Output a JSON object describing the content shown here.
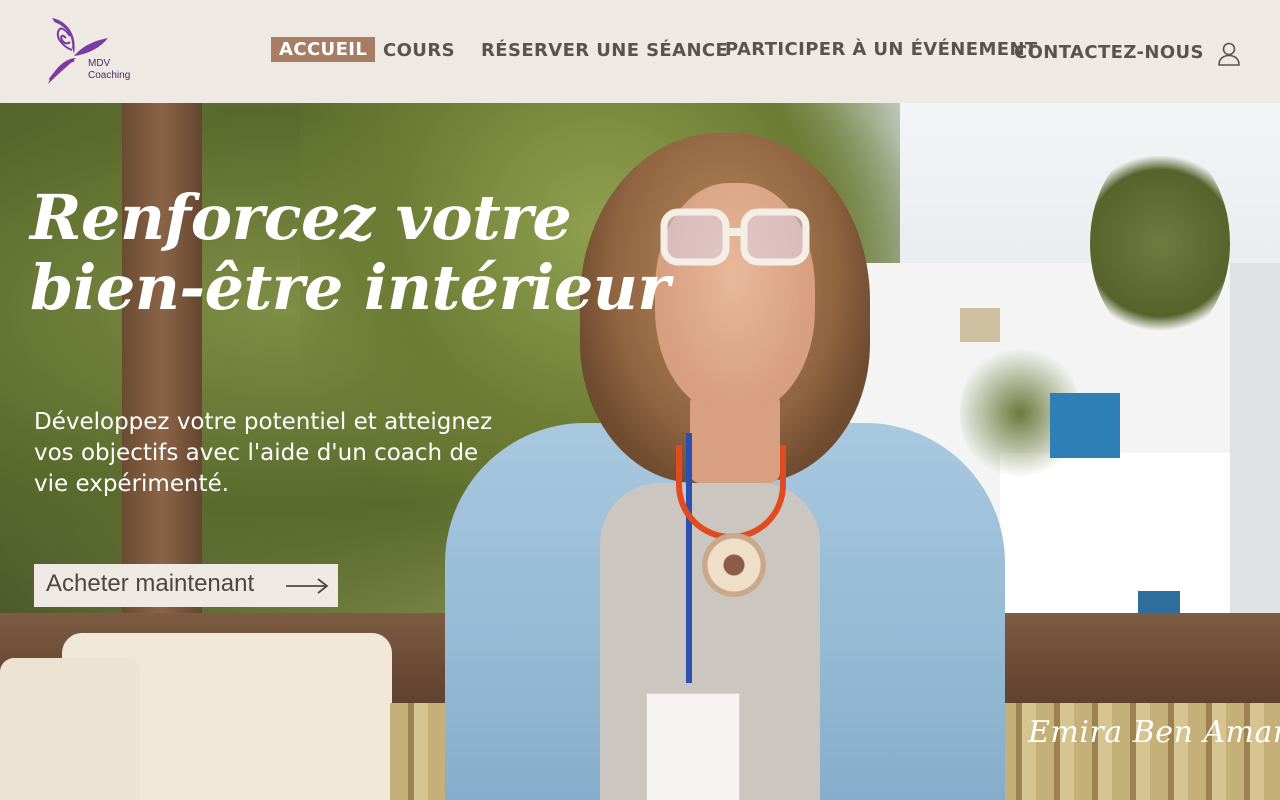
{
  "brand": {
    "logo_icon": "butterfly-logo-icon",
    "name_line1": "MDV",
    "name_line2": "Coaching"
  },
  "nav": {
    "items": [
      {
        "label": "ACCUEIL",
        "active": true
      },
      {
        "label": "COURS",
        "active": false
      },
      {
        "label": "RÉSERVER UNE SÉANCE",
        "active": false
      },
      {
        "label": "PARTICIPER À UN ÉVÉNEMENT",
        "active": false
      },
      {
        "label": "CONTACTEZ-NOUS",
        "active": false
      }
    ],
    "account_icon": "user-icon"
  },
  "hero": {
    "title_line1": "Renforcez votre",
    "title_line2": "bien-être intérieur",
    "subtitle": "Développez votre potentiel et atteignez vos objectifs avec l'aide d'un coach de vie expérimenté.",
    "cta_label": "Acheter maintenant",
    "cta_icon": "arrow-right-icon",
    "signature": "Emira Ben Amara"
  },
  "colors": {
    "header_bg": "#efe9e3",
    "nav_active_bg": "#a77e63",
    "nav_text": "#5a524c",
    "logo_purple": "#7a3aa0",
    "hero_text": "#ffffff"
  }
}
